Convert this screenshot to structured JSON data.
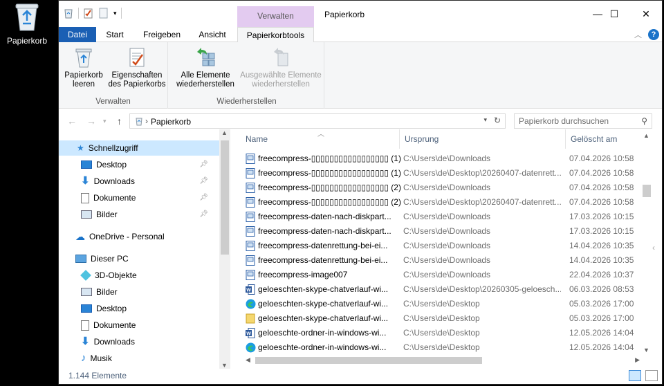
{
  "desktop": {
    "icon_label": "Papierkorb"
  },
  "window": {
    "title": "Papierkorb",
    "context_group": "Verwalten",
    "controls": {
      "minimize": "—",
      "maximize": "☐",
      "close": "✕"
    }
  },
  "tabs": [
    "Datei",
    "Start",
    "Freigeben",
    "Ansicht",
    "Papierkorbtools"
  ],
  "ribbon": {
    "groups": [
      {
        "label": "Verwalten",
        "buttons": [
          {
            "label": "Papierkorb\nleeren"
          },
          {
            "label": "Eigenschaften\ndes Papierkorbs"
          }
        ]
      },
      {
        "label": "Wiederherstellen",
        "buttons": [
          {
            "label": "Alle Elemente\nwiederherstellen"
          },
          {
            "label": "Ausgewählte Elemente\nwiederherstellen"
          }
        ]
      }
    ]
  },
  "address": {
    "crumb": "Papierkorb",
    "search_placeholder": "Papierkorb durchsuchen"
  },
  "nav": {
    "quick_access": "Schnellzugriff",
    "quick_items": [
      "Desktop",
      "Downloads",
      "Dokumente",
      "Bilder"
    ],
    "onedrive": "OneDrive - Personal",
    "this_pc": "Dieser PC",
    "pc_items": [
      "3D-Objekte",
      "Bilder",
      "Desktop",
      "Dokumente",
      "Downloads",
      "Musik"
    ]
  },
  "columns": {
    "name": "Name",
    "origin": "Ursprung",
    "deleted": "Gelöscht am"
  },
  "files": [
    {
      "name": "freecompress-▯▯▯▯▯▯▯▯▯▯▯▯▯▯▯▯▯ (1)",
      "origin": "C:\\Users\\de\\Downloads",
      "date": "07.04.2026 10:58",
      "type": "doc"
    },
    {
      "name": "freecompress-▯▯▯▯▯▯▯▯▯▯▯▯▯▯▯▯▯ (1)",
      "origin": "C:\\Users\\de\\Desktop\\20260407-datenrett...",
      "date": "07.04.2026 10:58",
      "type": "doc"
    },
    {
      "name": "freecompress-▯▯▯▯▯▯▯▯▯▯▯▯▯▯▯▯▯ (2)",
      "origin": "C:\\Users\\de\\Downloads",
      "date": "07.04.2026 10:58",
      "type": "doc"
    },
    {
      "name": "freecompress-▯▯▯▯▯▯▯▯▯▯▯▯▯▯▯▯▯ (2)",
      "origin": "C:\\Users\\de\\Desktop\\20260407-datenrett...",
      "date": "07.04.2026 10:58",
      "type": "doc"
    },
    {
      "name": "freecompress-daten-nach-diskpart...",
      "origin": "C:\\Users\\de\\Downloads",
      "date": "17.03.2026 10:15",
      "type": "doc"
    },
    {
      "name": "freecompress-daten-nach-diskpart...",
      "origin": "C:\\Users\\de\\Downloads",
      "date": "17.03.2026 10:15",
      "type": "doc"
    },
    {
      "name": "freecompress-datenrettung-bei-ei...",
      "origin": "C:\\Users\\de\\Downloads",
      "date": "14.04.2026 10:35",
      "type": "doc"
    },
    {
      "name": "freecompress-datenrettung-bei-ei...",
      "origin": "C:\\Users\\de\\Downloads",
      "date": "14.04.2026 10:35",
      "type": "doc"
    },
    {
      "name": "freecompress-image007",
      "origin": "C:\\Users\\de\\Downloads",
      "date": "22.04.2026 10:37",
      "type": "doc"
    },
    {
      "name": "geloeschten-skype-chatverlauf-wi...",
      "origin": "C:\\Users\\de\\Desktop\\20260305-geloesch...",
      "date": "06.03.2026 08:53",
      "type": "word"
    },
    {
      "name": "geloeschten-skype-chatverlauf-wi...",
      "origin": "C:\\Users\\de\\Desktop",
      "date": "05.03.2026 17:00",
      "type": "edge"
    },
    {
      "name": "geloeschten-skype-chatverlauf-wi...",
      "origin": "C:\\Users\\de\\Desktop",
      "date": "05.03.2026 17:00",
      "type": "folder"
    },
    {
      "name": "geloeschte-ordner-in-windows-wi...",
      "origin": "C:\\Users\\de\\Desktop",
      "date": "12.05.2026 14:04",
      "type": "word"
    },
    {
      "name": "geloeschte-ordner-in-windows-wi...",
      "origin": "C:\\Users\\de\\Desktop",
      "date": "12.05.2026 14:04",
      "type": "edge"
    }
  ],
  "status": {
    "count": "1.144 Elemente"
  },
  "colors": {
    "file_tab": "#1a5fb4",
    "context_tab": "#e3cbf0",
    "selected": "#cce8ff"
  }
}
